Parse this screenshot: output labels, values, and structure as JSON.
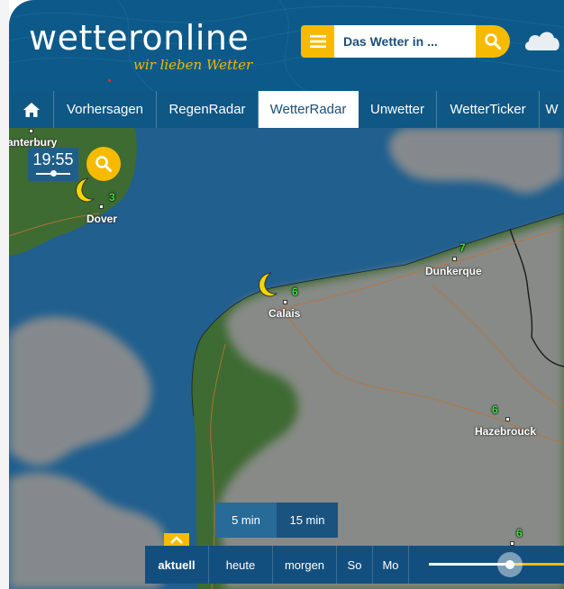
{
  "brand": {
    "name": "wetteronline",
    "tagline": "wir lieben Wetter"
  },
  "search": {
    "placeholder": "Das Wetter in ..."
  },
  "nav": [
    "Vorhersagen",
    "RegenRadar",
    "WetterRadar",
    "Unwetter",
    "WetterTicker",
    "W"
  ],
  "nav_active": "WetterRadar",
  "map": {
    "time": "19:55",
    "cities": [
      "anterbury",
      "Dover",
      "Calais",
      "Dunkerque",
      "Hazebrouck"
    ],
    "temps": [
      "3",
      "6",
      "7",
      "6",
      "6"
    ]
  },
  "interval": [
    "5 min",
    "15 min"
  ],
  "timeline": {
    "days": [
      "aktuell",
      "heute",
      "morgen",
      "So",
      "Mo"
    ],
    "active": "aktuell",
    "position": 0.6
  },
  "colors": {
    "header": "#0d5a8a",
    "accent": "#f6bb00",
    "sea": "#205f8e",
    "land": "#3e6b32",
    "cloud": "#8c8c8c"
  }
}
